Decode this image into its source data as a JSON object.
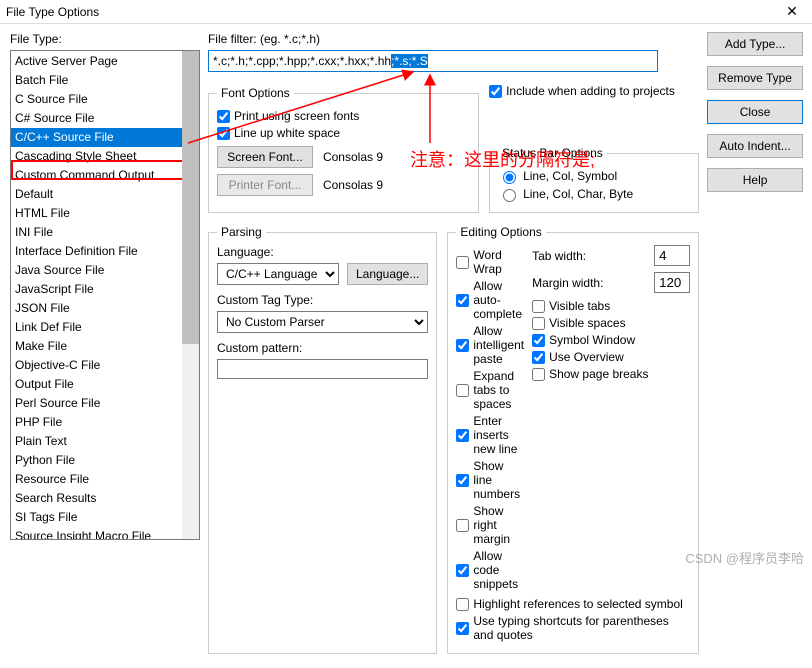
{
  "title": "File Type Options",
  "left": {
    "label": "File Type:",
    "items": [
      "Active Server Page",
      "Batch File",
      "C Source File",
      "C# Source File",
      "C/C++ Source File",
      "Cascading Style Sheet",
      "Custom Command Output",
      "Default",
      "HTML File",
      "INI File",
      "Interface Definition File",
      "Java Source File",
      "JavaScript File",
      "JSON File",
      "Link Def File",
      "Make File",
      "Objective-C File",
      "Output File",
      "Perl Source File",
      "PHP File",
      "Plain Text",
      "Python File",
      "Resource File",
      "Search Results",
      "SI Tags File",
      "Source Insight Macro File"
    ],
    "selected_index": 4
  },
  "filter": {
    "label": "File filter: (eg. *.c;*.h)",
    "value_plain": "*.c;*.h;*.cpp;*.hpp;*.cxx;*.hxx;*.hh",
    "value_hl": ";*.s;*.S"
  },
  "include_cb": "Include when adding to projects",
  "font": {
    "legend": "Font Options",
    "cb1": "Print using screen fonts",
    "cb2": "Line up white space",
    "screen_btn": "Screen Font...",
    "printer_btn": "Printer Font...",
    "font_name1": "Consolas 9",
    "font_name2": "Consolas 9"
  },
  "status": {
    "legend": "Status Bar Options",
    "r1": "Line, Col, Symbol",
    "r2": "Line, Col, Char, Byte"
  },
  "parsing": {
    "legend": "Parsing",
    "lang_label": "Language:",
    "lang_value": "C/C++ Language",
    "lang_btn": "Language...",
    "tag_label": "Custom Tag Type:",
    "tag_value": "No Custom Parser",
    "pattern_label": "Custom pattern:"
  },
  "editing": {
    "legend": "Editing Options",
    "cb_wordwrap": "Word Wrap",
    "cb_autocomplete": "Allow auto-complete",
    "cb_intellipaste": "Allow intelligent paste",
    "cb_expandtabs": "Expand tabs to spaces",
    "cb_enterinsert": "Enter inserts new line",
    "cb_linenums": "Show line numbers",
    "cb_rmargin": "Show right margin",
    "cb_snippets": "Allow code snippets",
    "cb_hlrefs": "Highlight references to selected symbol",
    "cb_shortcuts": "Use typing shortcuts for parentheses and quotes",
    "tabw_label": "Tab width:",
    "tabw_value": "4",
    "marginw_label": "Margin width:",
    "marginw_value": "120",
    "cb_vistabs": "Visible tabs",
    "cb_visspaces": "Visible spaces",
    "cb_symwin": "Symbol Window",
    "cb_overview": "Use Overview",
    "cb_pagebreaks": "Show page breaks"
  },
  "buttons": {
    "add": "Add Type...",
    "remove": "Remove Type",
    "close": "Close",
    "auto": "Auto Indent...",
    "help": "Help"
  },
  "annotation": "注意：这里的分隔符是;",
  "watermark": "CSDN @程序员李哈"
}
